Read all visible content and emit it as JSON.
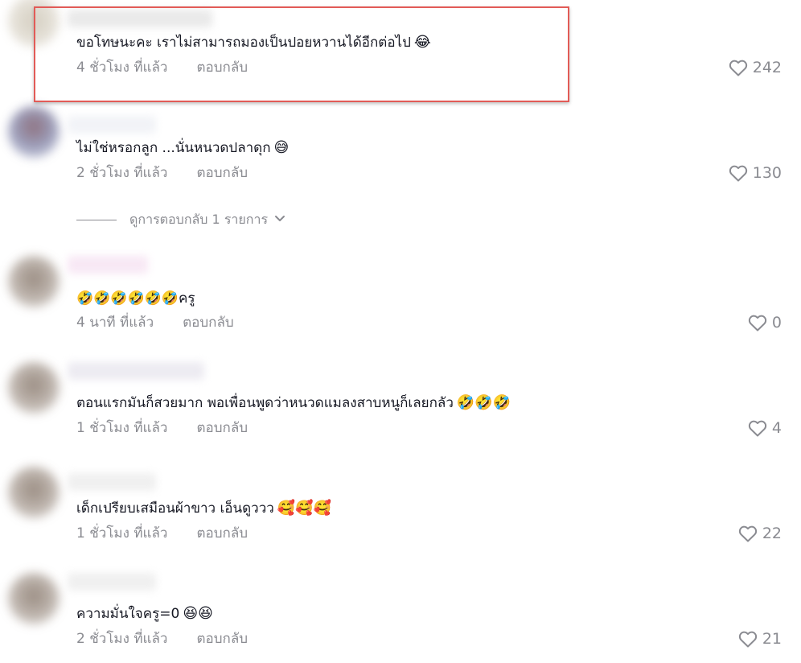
{
  "comments": [
    {
      "text": "ขอโทษนะคะ เราไม่สามารถมองเป็นปอยหวานได้อีกต่อไป",
      "emoji": "😂",
      "time": "4 ชั่วโมง ที่แล้ว",
      "reply": "ตอบกลับ",
      "likes": "242"
    },
    {
      "text": "ไม่ใช่หรอกลูก ...นั่นหนวดปลาดุก",
      "emoji": "😅",
      "time": "2 ชั่วโมง ที่แล้ว",
      "reply": "ตอบกลับ",
      "likes": "130"
    },
    {
      "text": "🤣🤣🤣🤣🤣🤣ครู",
      "emoji": "",
      "time": "4 นาที ที่แล้ว",
      "reply": "ตอบกลับ",
      "likes": "0"
    },
    {
      "text": "ตอนแรกมันก็สวยมาก พอเพื่อนพูดว่าหนวดแมลงสาบหนูก็เลยกลัว",
      "emoji": "🤣🤣🤣",
      "time": "1 ชั่วโมง ที่แล้ว",
      "reply": "ตอบกลับ",
      "likes": "4"
    },
    {
      "text": "เด็กเปรียบเสมือนผ้าขาว เอ็นดูววว",
      "emoji": "🥰🥰🥰",
      "time": "1 ชั่วโมง ที่แล้ว",
      "reply": "ตอบกลับ",
      "likes": "22"
    },
    {
      "text": "ความมั่นใจครู=0",
      "emoji": "😆😆",
      "time": "2 ชั่วโมง ที่แล้ว",
      "reply": "ตอบกลับ",
      "likes": "21"
    }
  ],
  "view_replies": "ดูการตอบกลับ 1 รายการ",
  "icons": {
    "like": "heart-outline-icon",
    "expand": "chevron-down-icon"
  },
  "colors": {
    "highlight": "#e25b57",
    "meta": "#8a8b91",
    "text": "#161823"
  }
}
